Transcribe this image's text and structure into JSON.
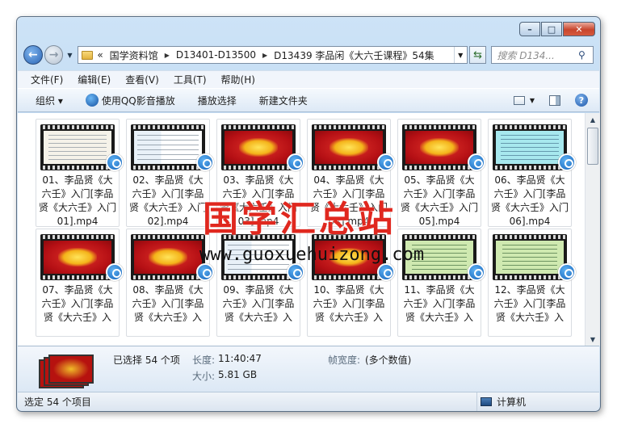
{
  "window": {
    "controls": {
      "minimize": "–",
      "maximize": "□",
      "close": "✕"
    }
  },
  "address": {
    "overflow": "«",
    "crumbs": [
      "国学资料馆",
      "D13401-D13500",
      "D13439 李品闲《大六壬课程》54集"
    ],
    "search_placeholder": "搜索 D134..."
  },
  "menu": [
    "文件(F)",
    "编辑(E)",
    "查看(V)",
    "工具(T)",
    "帮助(H)"
  ],
  "toolbar": {
    "organize": "组织 ▾",
    "play_qq": "使用QQ影音播放",
    "play_select": "播放选择",
    "new_folder": "新建文件夹"
  },
  "files": [
    {
      "name": "01、李品贤《大六壬》入门[李品贤《大六壬》入门01].mp4",
      "thumb": "doc"
    },
    {
      "name": "02、李品贤《大六壬》入门[李品贤《大六壬》入门02].mp4",
      "thumb": "mixed"
    },
    {
      "name": "03、李品贤《大六壬》入门[李品贤《大六壬》入门03].mp4",
      "thumb": "red"
    },
    {
      "name": "04、李品贤《大六壬》入门[李品贤《大六壬》入门04].mp4",
      "thumb": "red"
    },
    {
      "name": "05、李品贤《大六壬》入门[李品贤《大六壬》入门05].mp4",
      "thumb": "red"
    },
    {
      "name": "06、李品贤《大六壬》入门[李品贤《大六壬》入门06].mp4",
      "thumb": "cyan"
    },
    {
      "name": "07、李品贤《大六壬》入门[李品贤《大六壬》入",
      "thumb": "red"
    },
    {
      "name": "08、李品贤《大六壬》入门[李品贤《大六壬》入",
      "thumb": "red"
    },
    {
      "name": "09、李品贤《大六壬》入门[李品贤《大六壬》入",
      "thumb": "mixed"
    },
    {
      "name": "10、李品贤《大六壬》入门[李品贤《大六壬》入",
      "thumb": "red"
    },
    {
      "name": "11、李品贤《大六壬》入门[李品贤《大六壬》入",
      "thumb": "green"
    },
    {
      "name": "12、李品贤《大六壬》入门[李品贤《大六壬》入",
      "thumb": "green"
    }
  ],
  "watermark": {
    "text": "国学汇总站",
    "url": "www.guoxuehuizong.com"
  },
  "details": {
    "selected": "已选择 54 个项",
    "length_label": "长度:",
    "length_value": "11:40:47",
    "size_label": "大小:",
    "size_value": "5.81 GB",
    "framewidth_label": "帧宽度:",
    "framewidth_value": "(多个数值)"
  },
  "status": {
    "left": "选定 54 个项目",
    "right": "计算机"
  }
}
